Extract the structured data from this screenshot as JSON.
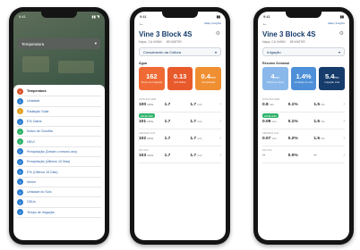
{
  "phone1": {
    "status_time": "9:41",
    "status_icons": "▮▮ ◥",
    "dropdown_label": "Temperatura",
    "dropdown_icon": "chevron-down-icon",
    "items": [
      {
        "label": "Temperatura",
        "color": "#d9532c",
        "icon": "thermometer-icon",
        "active": true
      },
      {
        "label": "Umidade",
        "color": "#2f7fd0",
        "icon": "drop-icon",
        "active": false
      },
      {
        "label": "Radiação Solar",
        "color": "#e2a021",
        "icon": "sun-icon",
        "active": false
      },
      {
        "label": "ETc Diária",
        "color": "#2f7fd0",
        "icon": "leaf-icon",
        "active": false
      },
      {
        "label": "Índice de Clorofila",
        "color": "#2fb36a",
        "icon": "leaf-icon",
        "active": false
      },
      {
        "label": "NDVI",
        "color": "#2fb36a",
        "icon": "satellite-icon",
        "active": false
      },
      {
        "label": "Precipitação (Desde o mesmo ano)",
        "color": "#2f7fd0",
        "icon": "rain-icon",
        "active": false
      },
      {
        "label": "Precipitação (Últimos 15 Dias)",
        "color": "#2f7fd0",
        "icon": "rain-icon",
        "active": false
      },
      {
        "label": "ETc (Últimos 15 Dias)",
        "color": "#2f7fd0",
        "icon": "drop-icon",
        "active": false
      },
      {
        "label": "Irrimin",
        "color": "#2f7fd0",
        "icon": "drop-icon",
        "active": false
      },
      {
        "label": "Umidade do Solo",
        "color": "#2f7fd0",
        "icon": "soil-icon",
        "active": false
      },
      {
        "label": "GDUs",
        "color": "#2f7fd0",
        "icon": "chart-icon",
        "active": false
      },
      {
        "label": "Tempo de Irrigação",
        "color": "#2f7fd0",
        "icon": "clock-icon",
        "active": false
      }
    ]
  },
  "phone2": {
    "status_time": "9:41",
    "back_icon": "←",
    "brand": "Valley Insights",
    "title": "Vine 3 Block 4S",
    "meta1": "Napa, CA 94560",
    "meta2": "85 WATER",
    "selector_label": "Crescimento da Cultura",
    "section": "Água",
    "cards": [
      {
        "value": "162",
        "unit": "",
        "label": "Tempo de Irrigação",
        "color": "#ef6a35"
      },
      {
        "value": "0.13",
        "unit": "",
        "label": "ETc Diária",
        "color": "#e85a2c"
      },
      {
        "value": "0.4",
        "unit": "mm",
        "label": "Precipitação",
        "color": "#f08f32"
      }
    ],
    "rows": [
      {
        "date": "DATA/DIA SEM",
        "tag": "",
        "c1": "100",
        "c1u": "kW/a",
        "c2": "1.7",
        "c3": "1.7",
        "c3u": "mm"
      },
      {
        "date": "",
        "tag": "HOJE 4/22",
        "c1": "101",
        "c1u": "kW/a",
        "c2": "1.7",
        "c3": "1.7",
        "c3u": "mm"
      },
      {
        "date": "AMANHÃ 4/23",
        "tag": "",
        "c1": "102",
        "c1u": "kW/a",
        "c2": "1.7",
        "c3": "1.7",
        "c3u": "mm"
      },
      {
        "date": "DIA 4/24",
        "tag": "",
        "c1": "103",
        "c1u": "kW/a",
        "c2": "1.7",
        "c3": "1.7",
        "c3u": "mm"
      }
    ]
  },
  "phone3": {
    "status_time": "9:41",
    "back_icon": "←",
    "brand": "Valley Insights",
    "title": "Vine 3 Block 4S",
    "meta1": "Napa, CA 94560",
    "meta2": "85 WATER",
    "selector_label": "Irrigação",
    "section": "Resumo Semanal",
    "cards": [
      {
        "value": "4",
        "unit": "mm",
        "label": "Déficit de Água",
        "color": "#8ab8ea"
      },
      {
        "value": "1.4%",
        "unit": "",
        "label": "Umidade do solo",
        "color": "#4d8fd8"
      },
      {
        "value": "5.4",
        "unit": "hrs",
        "label": "Irrigação total",
        "color": "#163c6b"
      }
    ],
    "rows": [
      {
        "date": "DATA/DIA SEM",
        "tag": "",
        "c1": "0.8",
        "c1u": "mm",
        "c2": "0.1%",
        "c3": "1.5",
        "c3u": "hrs"
      },
      {
        "date": "",
        "tag": "HOJE 4/22",
        "c1": "0.09",
        "c1u": "mm",
        "c2": "0.1%",
        "c3": "1.5",
        "c3u": "hrs"
      },
      {
        "date": "AMANHÃ 4/23",
        "tag": "",
        "c1": "0.07",
        "c1u": "mm",
        "c2": "0.2%",
        "c3": "1.5",
        "c3u": "hrs"
      },
      {
        "date": "DIA 4/24",
        "tag": "",
        "c1": "--",
        "c1u": "",
        "c2": "0.0%",
        "c3": "--",
        "c3u": ""
      }
    ]
  }
}
